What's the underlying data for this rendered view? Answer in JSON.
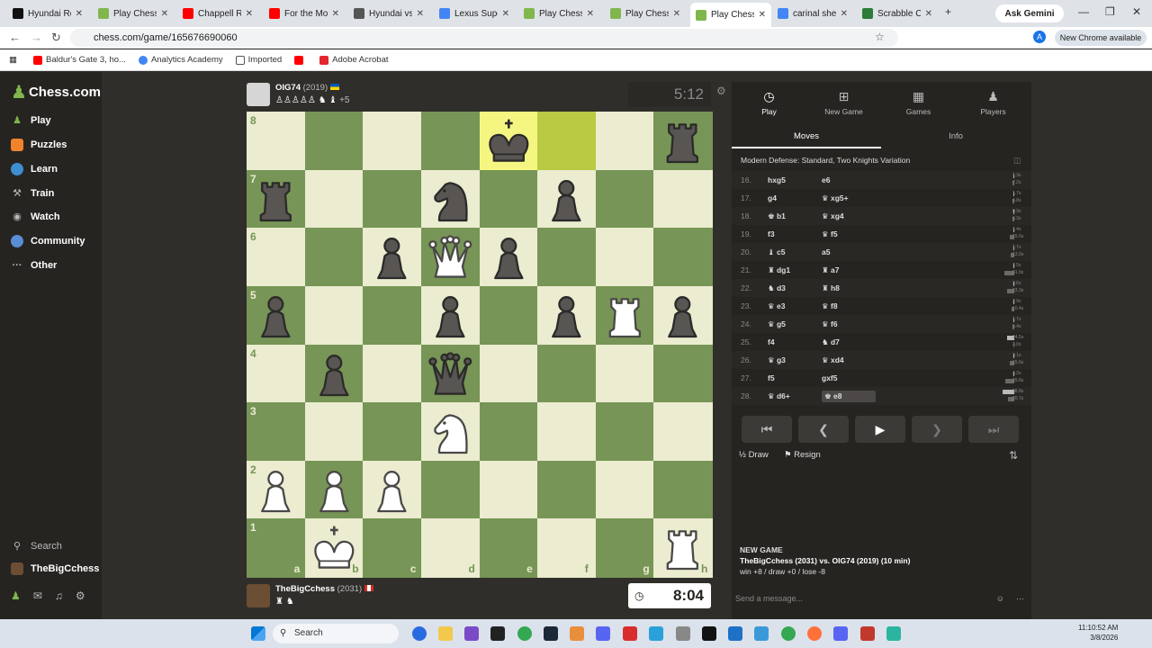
{
  "browser": {
    "tabs": [
      {
        "title": "Hyundai Robo",
        "icon": "hyundai-favicon",
        "color": "#111111"
      },
      {
        "title": "Play Chess",
        "icon": "chess-favicon",
        "color": "#81b64c"
      },
      {
        "title": "Chappell Roan",
        "icon": "youtube-favicon",
        "color": "#ff0000"
      },
      {
        "title": "For the Mobile",
        "icon": "youtube-favicon",
        "color": "#ff0000"
      },
      {
        "title": "Hyundai vs Ts",
        "icon": "hyundai-favicon",
        "color": "#555555"
      },
      {
        "title": "Lexus Super",
        "icon": "google-favicon",
        "color": "#4285f4"
      },
      {
        "title": "Play Chess",
        "icon": "chess-favicon",
        "color": "#81b64c"
      },
      {
        "title": "Play Chess",
        "icon": "chess-favicon",
        "color": "#81b64c"
      },
      {
        "title": "Play Chess",
        "icon": "chess-favicon",
        "color": "#81b64c"
      },
      {
        "title": "carinal shell g",
        "icon": "google-favicon",
        "color": "#4285f4"
      },
      {
        "title": "Scrabble Che",
        "icon": "scrabble-favicon",
        "color": "#2d7c3a"
      }
    ],
    "ask_gemini": "Ask Gemini",
    "url": "chess.com/game/165676690060",
    "new_chrome": "New Chrome available",
    "bookmarks": [
      "Baldur's Gate 3, ho...",
      "Analytics Academy",
      "Imported",
      "",
      "Adobe Acrobat"
    ]
  },
  "sidebar": {
    "logo": "Chess.com",
    "items": [
      "Play",
      "Puzzles",
      "Learn",
      "Train",
      "Watch",
      "Community",
      "Other"
    ],
    "search": "Search",
    "user": "TheBigCchess"
  },
  "top_player": {
    "name": "OIG74",
    "rating": "(2019)",
    "flag": "ukraine-flag",
    "captured": "+5"
  },
  "bottom_player": {
    "name": "TheBigCchess",
    "rating": "(2031)",
    "flag": "canada-flag"
  },
  "clocks": {
    "top": "5:12",
    "bottom": "8:04"
  },
  "board": {
    "files": [
      "a",
      "b",
      "c",
      "d",
      "e",
      "f",
      "g",
      "h"
    ],
    "ranks": [
      "8",
      "7",
      "6",
      "5",
      "4",
      "3",
      "2",
      "1"
    ],
    "highlight": [
      "e8",
      "f8"
    ],
    "pieces": [
      {
        "sq": "e8",
        "p": "k",
        "c": "b"
      },
      {
        "sq": "h8",
        "p": "r",
        "c": "b"
      },
      {
        "sq": "a7",
        "p": "r",
        "c": "b"
      },
      {
        "sq": "d7",
        "p": "n",
        "c": "b"
      },
      {
        "sq": "f7",
        "p": "p",
        "c": "b"
      },
      {
        "sq": "c6",
        "p": "p",
        "c": "b"
      },
      {
        "sq": "d6",
        "p": "q",
        "c": "w"
      },
      {
        "sq": "e6",
        "p": "p",
        "c": "b"
      },
      {
        "sq": "a5",
        "p": "p",
        "c": "b"
      },
      {
        "sq": "d5",
        "p": "p",
        "c": "b"
      },
      {
        "sq": "f5",
        "p": "p",
        "c": "b"
      },
      {
        "sq": "g5",
        "p": "r",
        "c": "w"
      },
      {
        "sq": "h5",
        "p": "p",
        "c": "b"
      },
      {
        "sq": "b4",
        "p": "p",
        "c": "b"
      },
      {
        "sq": "d4",
        "p": "q",
        "c": "b"
      },
      {
        "sq": "d3",
        "p": "n",
        "c": "w"
      },
      {
        "sq": "a2",
        "p": "p",
        "c": "w"
      },
      {
        "sq": "b2",
        "p": "p",
        "c": "w"
      },
      {
        "sq": "c2",
        "p": "p",
        "c": "w"
      },
      {
        "sq": "b1",
        "p": "k",
        "c": "w"
      },
      {
        "sq": "h1",
        "p": "r",
        "c": "w"
      }
    ]
  },
  "panel": {
    "tabs": [
      "Play",
      "New Game",
      "Games",
      "Players"
    ],
    "subtabs": [
      "Moves",
      "Info"
    ],
    "opening": "Modern Defense: Standard, Two Knights Variation",
    "moves": [
      {
        "n": "16.",
        "w": "hxg5",
        "b": "e6",
        "t1": "1.3s",
        "t2": "7.2s"
      },
      {
        "n": "17.",
        "w": "g4",
        "b": "xg5+",
        "t1": "1.7s",
        "t2": "4.8s"
      },
      {
        "n": "18.",
        "w": "b1",
        "b": "xg4",
        "t1": "0.9s",
        "t2": "6.3s"
      },
      {
        "n": "19.",
        "w": "f3",
        "b": "f5",
        "t1": "1.4s",
        "t2": "15.0s"
      },
      {
        "n": "20.",
        "w": "c5",
        "b": "a5",
        "t1": "1.7s",
        "t2": "13.0s"
      },
      {
        "n": "21.",
        "w": "dg1",
        "b": "a7",
        "t1": "2.5s",
        "t2": "31.9s"
      },
      {
        "n": "22.",
        "w": "d3",
        "b": "h8",
        "t1": "3.6s",
        "t2": "23.3s"
      },
      {
        "n": "23.",
        "w": "e3",
        "b": "f8",
        "t1": "2.9s",
        "t2": "10.4s"
      },
      {
        "n": "24.",
        "w": "g5",
        "b": "f6",
        "t1": "1.7s",
        "t2": "5.4s"
      },
      {
        "n": "25.",
        "w": "f4",
        "b": "d7",
        "t1": "24.5s",
        "t2": "3.0s"
      },
      {
        "n": "26.",
        "w": "g3",
        "b": "xd4",
        "t1": "3.1s",
        "t2": "15.6s"
      },
      {
        "n": "27.",
        "w": "f5",
        "b": "gxf5",
        "t1": "4.2s",
        "t2": "29.8s"
      },
      {
        "n": "28.",
        "w": "d6+",
        "b": "e8",
        "t1": "38.8s",
        "t2": "20.7s"
      }
    ],
    "draw": "Draw",
    "resign": "Resign",
    "new_game_title": "NEW GAME",
    "new_game_players": "TheBigCchess (2031) vs. OIG74 (2019) (10 min)",
    "new_game_stats": "win +8 / draw +0 / lose -8",
    "message_placeholder": "Send a message..."
  },
  "taskbar": {
    "search": "Search",
    "time": "11:10:52 AM",
    "date": "3/8/2026"
  }
}
